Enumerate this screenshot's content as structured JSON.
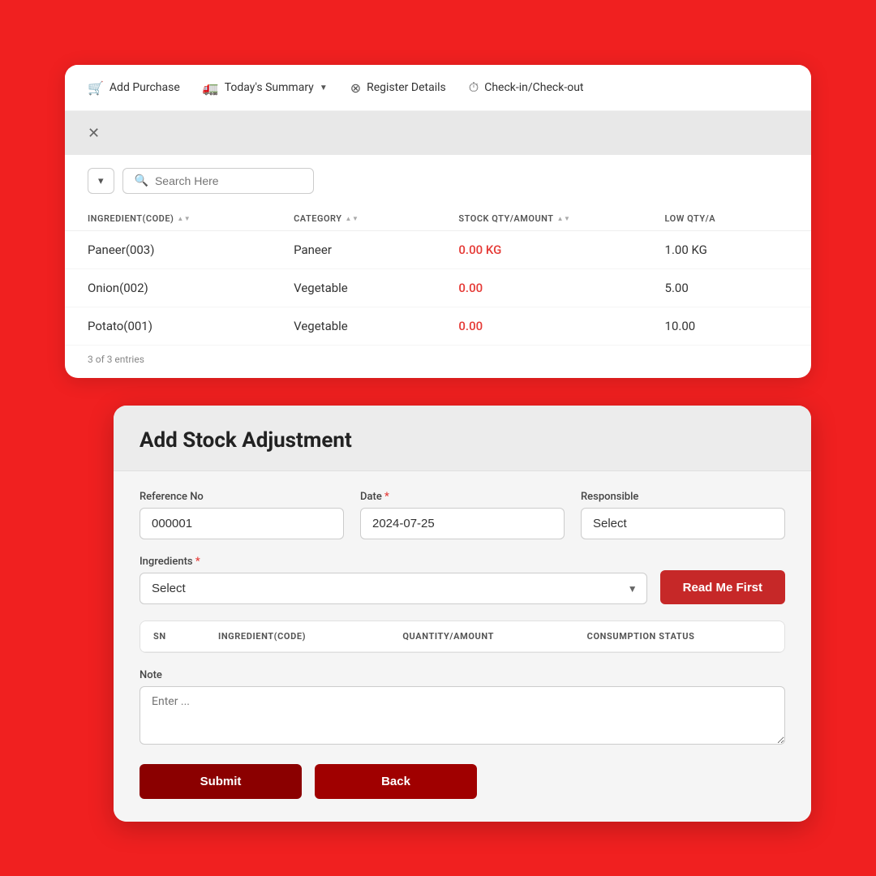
{
  "nav": {
    "items": [
      {
        "id": "add-purchase",
        "label": "Add Purchase",
        "icon": "🛒",
        "hasDropdown": false
      },
      {
        "id": "todays-summary",
        "label": "Today's Summary",
        "icon": "🚛",
        "hasDropdown": true
      },
      {
        "id": "register-details",
        "label": "Register Details",
        "icon": "⊗",
        "hasDropdown": false
      },
      {
        "id": "checkin-checkout",
        "label": "Check-in/Check-out",
        "icon": "⏱",
        "hasDropdown": false
      }
    ]
  },
  "search": {
    "placeholder": "Search Here"
  },
  "table": {
    "columns": [
      "INGREDIENT(CODE)",
      "CATEGORY",
      "STOCK QTY/AMOUNT",
      "LOW QTY/A"
    ],
    "rows": [
      {
        "ingredient": "Paneer(003)",
        "category": "Paneer",
        "stock": "0.00 KG",
        "stockIsRed": true,
        "lowQty": "1.00 KG"
      },
      {
        "ingredient": "Onion(002)",
        "category": "Vegetable",
        "stock": "0.00",
        "stockIsRed": true,
        "lowQty": "5.00"
      },
      {
        "ingredient": "Potato(001)",
        "category": "Vegetable",
        "stock": "0.00",
        "stockIsRed": true,
        "lowQty": "10.00"
      }
    ],
    "entries": "3 of 3 entries"
  },
  "form": {
    "title": "Add Stock Adjustment",
    "referenceNo": {
      "label": "Reference No",
      "value": "000001"
    },
    "date": {
      "label": "Date",
      "required": true,
      "value": "2024-07-25"
    },
    "responsible": {
      "label": "Responsible",
      "placeholder": "Select"
    },
    "ingredients": {
      "label": "Ingredients",
      "required": true,
      "placeholder": "Select"
    },
    "readMeBtn": "Read Me First",
    "miniTable": {
      "columns": [
        "SN",
        "INGREDIENT(CODE)",
        "QUANTITY/AMOUNT",
        "CONSUMPTION STATUS"
      ]
    },
    "note": {
      "label": "Note",
      "placeholder": "Enter ..."
    },
    "submitBtn": "Submit",
    "backBtn": "Back"
  }
}
